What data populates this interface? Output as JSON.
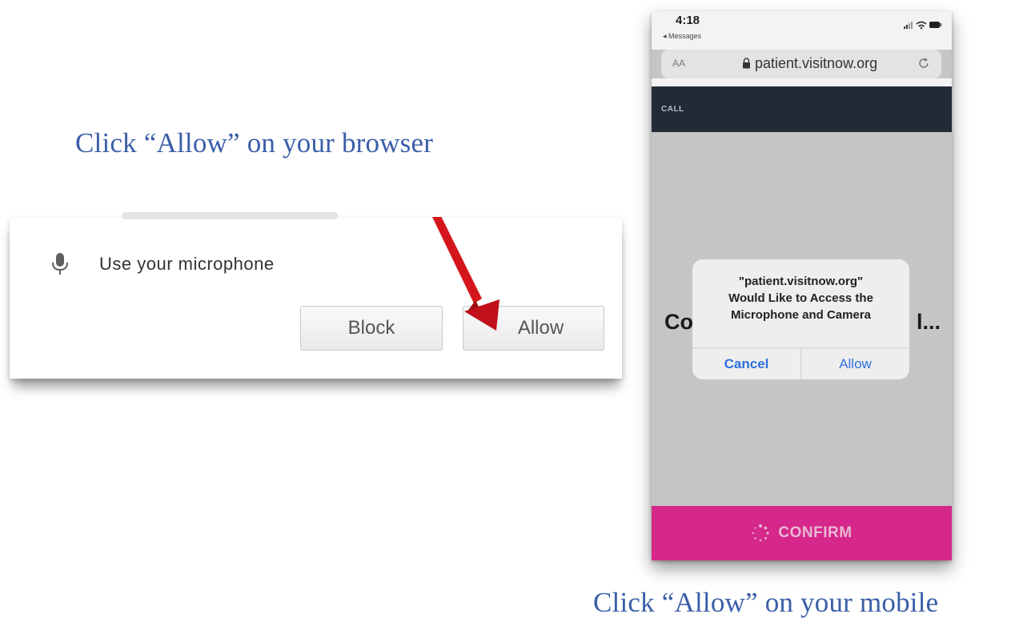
{
  "captions": {
    "browser": "Click “Allow” on your browser",
    "mobile": "Click “Allow” on your mobile"
  },
  "browser_prompt": {
    "permission_label": "Use your microphone",
    "permission_icon": "microphone-icon",
    "block_label": "Block",
    "allow_label": "Allow",
    "arrow_color": "#d4151c"
  },
  "mobile": {
    "status": {
      "time": "4:18",
      "back_app": "◂ Messages"
    },
    "browser": {
      "text_size_label": "AA",
      "url": "patient.visitnow.org"
    },
    "nav": {
      "label": "CALL"
    },
    "heading": {
      "visible_start": "Co",
      "visible_end": "l..."
    },
    "alert": {
      "line1": "\"patient.visitnow.org\"",
      "line2": "Would Like to Access the",
      "line3": "Microphone and Camera",
      "cancel_label": "Cancel",
      "allow_label": "Allow"
    },
    "confirm_label": "CONFIRM",
    "colors": {
      "navbar": "#232a36",
      "confirm_bar": "#d6278b",
      "alert_button_text": "#2d6fdb"
    }
  }
}
